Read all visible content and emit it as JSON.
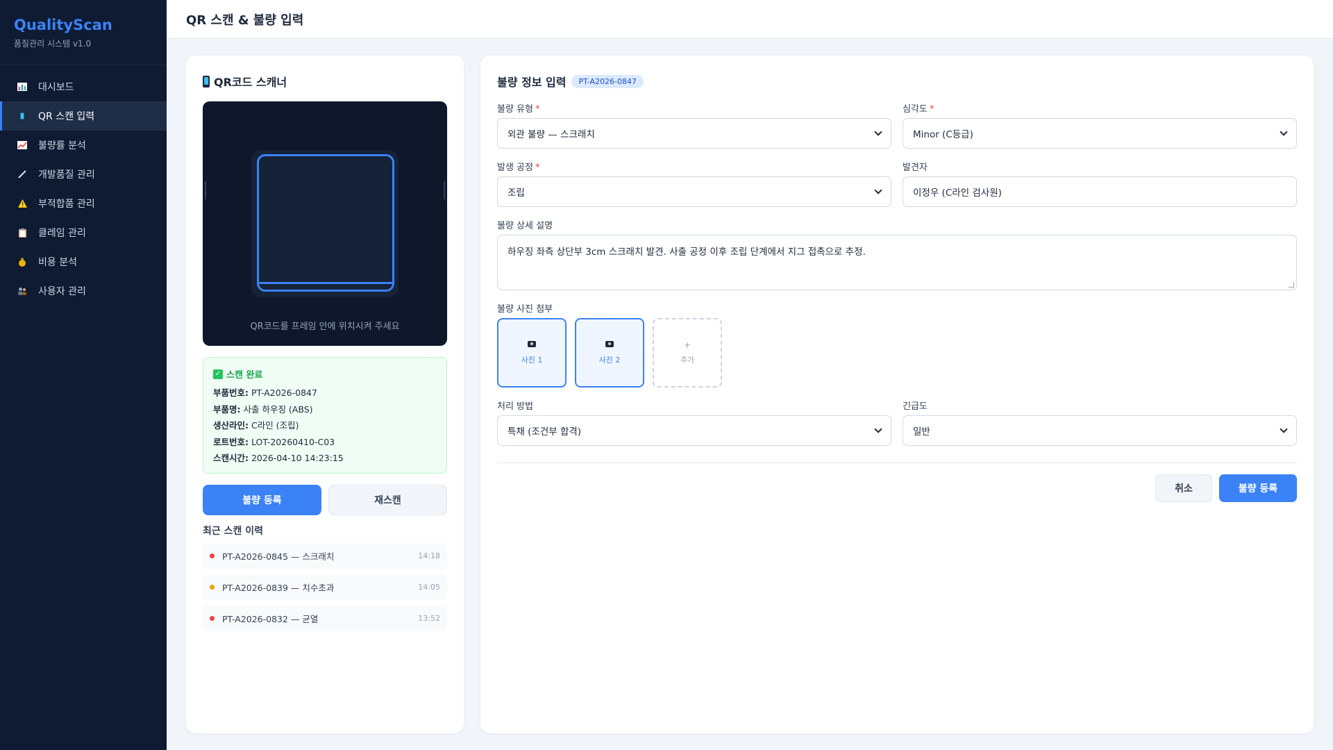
{
  "brand": {
    "title": "QualityScan",
    "subtitle": "품질관리 시스템 v1.0"
  },
  "sidebar": {
    "items": [
      {
        "label": "대시보드",
        "icon": "bar-chart-icon",
        "active": false
      },
      {
        "label": "QR 스캔 입력",
        "icon": "phone-icon",
        "active": true
      },
      {
        "label": "불량률 분석",
        "icon": "trend-chart-icon",
        "active": false
      },
      {
        "label": "개발품질 관리",
        "icon": "pencil-icon",
        "active": false
      },
      {
        "label": "부적합품 관리",
        "icon": "warning-icon",
        "active": false
      },
      {
        "label": "클레임 관리",
        "icon": "clipboard-icon",
        "active": false
      },
      {
        "label": "비용 분석",
        "icon": "money-bag-icon",
        "active": false
      },
      {
        "label": "사용자 관리",
        "icon": "users-icon",
        "active": false
      }
    ]
  },
  "header": {
    "title": "QR 스캔 & 불량 입력"
  },
  "scanner": {
    "title": "QR코드 스캐너",
    "hint": "QR코드를 프레임 안에 위치시켜 주세요",
    "result": {
      "status": "스캔 완료",
      "rows": [
        {
          "label": "부품번호:",
          "value": "PT-A2026-0847"
        },
        {
          "label": "부품명:",
          "value": "사출 하우징 (ABS)"
        },
        {
          "label": "생산라인:",
          "value": "C라인 (조립)"
        },
        {
          "label": "로트번호:",
          "value": "LOT-20260410-C03"
        },
        {
          "label": "스캔시간:",
          "value": "2026-04-10 14:23:15"
        }
      ]
    },
    "register_label": "불량 등록",
    "rescan_label": "재스캔",
    "history_title": "최근 스캔 이력",
    "history": [
      {
        "text": "PT-A2026-0845 — 스크래치",
        "time": "14:18",
        "color": "#ef4444"
      },
      {
        "text": "PT-A2026-0839 — 치수초과",
        "time": "14:05",
        "color": "#f59e0b"
      },
      {
        "text": "PT-A2026-0832 — 균열",
        "time": "13:52",
        "color": "#ef4444"
      }
    ]
  },
  "form": {
    "title": "불량 정보 입력",
    "part_tag": "PT-A2026-0847",
    "defect_type": {
      "label": "불량 유형",
      "value": "외관 불량 — 스크래치"
    },
    "severity": {
      "label": "심각도",
      "value": "Minor (C등급)"
    },
    "process": {
      "label": "발생 공정",
      "value": "조립"
    },
    "finder": {
      "label": "발견자",
      "value": "이정우 (C라인 검사원)"
    },
    "description": {
      "label": "불량 상세 설명",
      "value": "하우징 좌측 상단부 3cm 스크래치 발견. 사출 공정 이후 조립 단계에서 지그 접촉으로 추정."
    },
    "photos": {
      "label": "불량 사진 첨부",
      "items": [
        "사진 1",
        "사진 2"
      ],
      "add_label": "추가"
    },
    "disposition": {
      "label": "처리 방법",
      "value": "특채 (조건부 합격)"
    },
    "urgency": {
      "label": "긴급도",
      "value": "일반"
    },
    "cancel_label": "취소",
    "submit_label": "불량 등록",
    "required_mark": "*"
  },
  "colors": {
    "accent": "#3b82f6",
    "sidebar_bg": "#0f1b33",
    "success": "#16a34a",
    "danger": "#ef4444",
    "warning": "#f59e0b"
  }
}
